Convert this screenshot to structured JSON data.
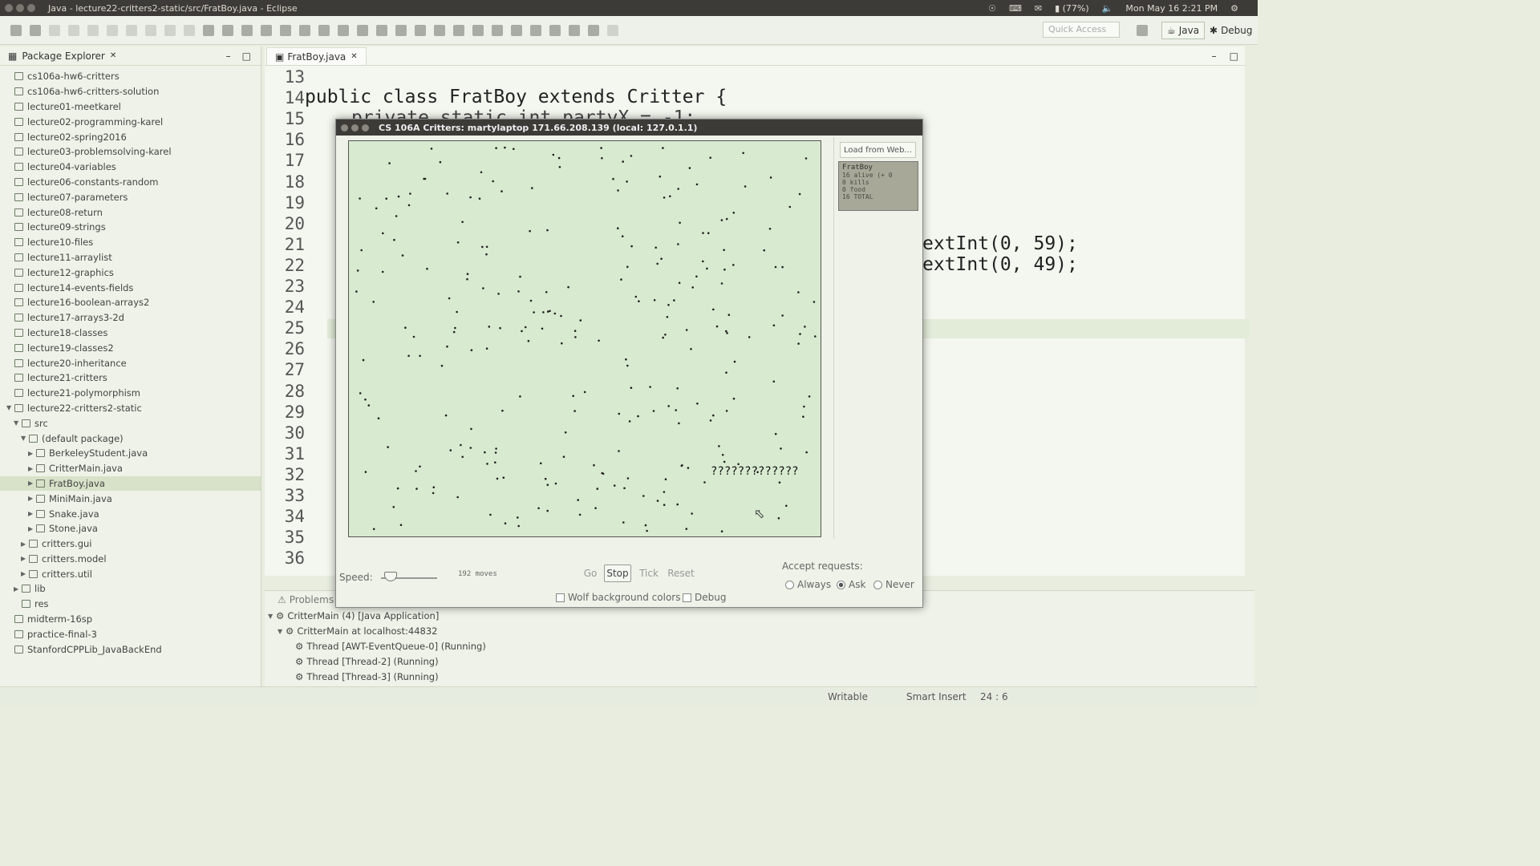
{
  "topbar": {
    "title": "Java - lecture22-critters2-static/src/FratBoy.java - Eclipse",
    "battery": "(77%)",
    "datetime": "Mon May 16  2:21 PM"
  },
  "toolbar": {
    "quick_access_placeholder": "Quick Access",
    "perspective_java": "Java",
    "perspective_debug": "Debug"
  },
  "package_explorer": {
    "title": "Package Explorer",
    "items": [
      {
        "label": "cs106a-hw6-critters",
        "depth": 0,
        "arrow": "",
        "selected": false
      },
      {
        "label": "cs106a-hw6-critters-solution",
        "depth": 0,
        "arrow": "",
        "selected": false
      },
      {
        "label": "lecture01-meetkarel",
        "depth": 0,
        "arrow": "",
        "selected": false
      },
      {
        "label": "lecture02-programming-karel",
        "depth": 0,
        "arrow": "",
        "selected": false
      },
      {
        "label": "lecture02-spring2016",
        "depth": 0,
        "arrow": "",
        "selected": false
      },
      {
        "label": "lecture03-problemsolving-karel",
        "depth": 0,
        "arrow": "",
        "selected": false
      },
      {
        "label": "lecture04-variables",
        "depth": 0,
        "arrow": "",
        "selected": false
      },
      {
        "label": "lecture06-constants-random",
        "depth": 0,
        "arrow": "",
        "selected": false
      },
      {
        "label": "lecture07-parameters",
        "depth": 0,
        "arrow": "",
        "selected": false
      },
      {
        "label": "lecture08-return",
        "depth": 0,
        "arrow": "",
        "selected": false
      },
      {
        "label": "lecture09-strings",
        "depth": 0,
        "arrow": "",
        "selected": false
      },
      {
        "label": "lecture10-files",
        "depth": 0,
        "arrow": "",
        "selected": false
      },
      {
        "label": "lecture11-arraylist",
        "depth": 0,
        "arrow": "",
        "selected": false
      },
      {
        "label": "lecture12-graphics",
        "depth": 0,
        "arrow": "",
        "selected": false
      },
      {
        "label": "lecture14-events-fields",
        "depth": 0,
        "arrow": "",
        "selected": false
      },
      {
        "label": "lecture16-boolean-arrays2",
        "depth": 0,
        "arrow": "",
        "selected": false
      },
      {
        "label": "lecture17-arrays3-2d",
        "depth": 0,
        "arrow": "",
        "selected": false
      },
      {
        "label": "lecture18-classes",
        "depth": 0,
        "arrow": "",
        "selected": false
      },
      {
        "label": "lecture19-classes2",
        "depth": 0,
        "arrow": "",
        "selected": false
      },
      {
        "label": "lecture20-inheritance",
        "depth": 0,
        "arrow": "",
        "selected": false
      },
      {
        "label": "lecture21-critters",
        "depth": 0,
        "arrow": "",
        "selected": false
      },
      {
        "label": "lecture21-polymorphism",
        "depth": 0,
        "arrow": "",
        "selected": false
      },
      {
        "label": "lecture22-critters2-static",
        "depth": 0,
        "arrow": "▼",
        "selected": false
      },
      {
        "label": "src",
        "depth": 1,
        "arrow": "▼",
        "selected": false
      },
      {
        "label": "(default package)",
        "depth": 2,
        "arrow": "▼",
        "selected": false
      },
      {
        "label": "BerkeleyStudent.java",
        "depth": 3,
        "arrow": "▶",
        "selected": false
      },
      {
        "label": "CritterMain.java",
        "depth": 3,
        "arrow": "▶",
        "selected": false
      },
      {
        "label": "FratBoy.java",
        "depth": 3,
        "arrow": "▶",
        "selected": true
      },
      {
        "label": "MiniMain.java",
        "depth": 3,
        "arrow": "▶",
        "selected": false
      },
      {
        "label": "Snake.java",
        "depth": 3,
        "arrow": "▶",
        "selected": false
      },
      {
        "label": "Stone.java",
        "depth": 3,
        "arrow": "▶",
        "selected": false
      },
      {
        "label": "critters.gui",
        "depth": 2,
        "arrow": "▶",
        "selected": false
      },
      {
        "label": "critters.model",
        "depth": 2,
        "arrow": "▶",
        "selected": false
      },
      {
        "label": "critters.util",
        "depth": 2,
        "arrow": "▶",
        "selected": false
      },
      {
        "label": "lib",
        "depth": 1,
        "arrow": "▶",
        "selected": false
      },
      {
        "label": "res",
        "depth": 1,
        "arrow": "",
        "selected": false
      },
      {
        "label": "midterm-16sp",
        "depth": 0,
        "arrow": "",
        "selected": false
      },
      {
        "label": "practice-final-3",
        "depth": 0,
        "arrow": "",
        "selected": false
      },
      {
        "label": "StanfordCPPLib_JavaBackEnd",
        "depth": 0,
        "arrow": "",
        "selected": false
      }
    ]
  },
  "editor": {
    "tab_label": "FratBoy.java",
    "line_numbers": [
      "13",
      "14",
      "15",
      "16",
      "17",
      "18",
      "19",
      "20",
      "21",
      "22",
      "23",
      "24",
      "25",
      "26",
      "27",
      "28",
      "29",
      "30",
      "31",
      "32",
      "33",
      "34",
      "35",
      "36"
    ],
    "class_line": "public class FratBoy extends Critter {",
    "hidden_line": "private static int partyX = -1;",
    "next_int_59": "extInt(0, 59);",
    "next_int_49": "extInt(0, 49);"
  },
  "bottom_panel": {
    "problems_tab": "Problems",
    "debug_items": [
      {
        "label": "CritterMain (4) [Java Application]",
        "indent": 0,
        "arrow": "▼"
      },
      {
        "label": "CritterMain at localhost:44832",
        "indent": 1,
        "arrow": "▼"
      },
      {
        "label": "Thread [AWT-EventQueue-0] (Running)",
        "indent": 2,
        "arrow": ""
      },
      {
        "label": "Thread [Thread-2] (Running)",
        "indent": 2,
        "arrow": ""
      },
      {
        "label": "Thread [Thread-3] (Running)",
        "indent": 2,
        "arrow": ""
      }
    ]
  },
  "statusbar": {
    "writable": "Writable",
    "insert_mode": "Smart Insert",
    "cursor_pos": "24 : 6"
  },
  "critters_window": {
    "title": "CS 106A Critters: martylaptop 171.66.208.139  (local: 127.0.1.1)",
    "load_from_web": "Load from Web...",
    "stats_title": "FratBoy",
    "stats_lines": [
      "16 alive (+ 0",
      "0 kills",
      "0 food",
      "16 TOTAL"
    ],
    "critter_glyphs": "?????????????",
    "speed_label": "Speed:",
    "moves_label": "192 moves",
    "go_label": "Go",
    "stop_label": "Stop",
    "tick_label": "Tick",
    "reset_label": "Reset",
    "accept_label": "Accept requests:",
    "always_label": "Always",
    "ask_label": "Ask",
    "never_label": "Never",
    "selected_accept": "Ask",
    "wolf_bg_label": "Wolf background colors",
    "debug_label": "Debug",
    "world_bg_color": "#d8ead0"
  }
}
